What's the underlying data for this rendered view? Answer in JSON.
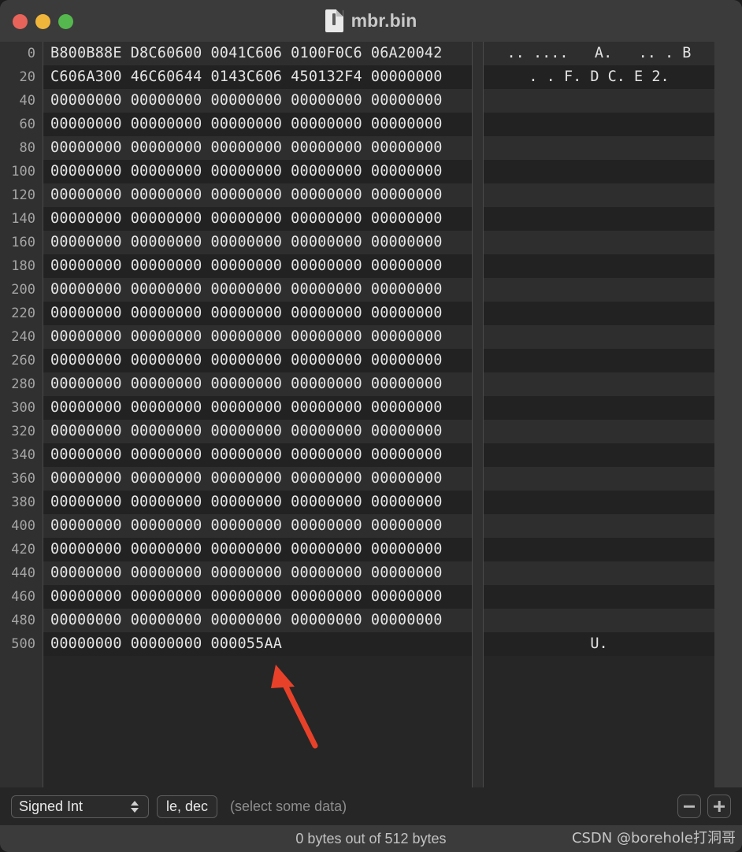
{
  "window": {
    "title": "mbr.bin",
    "doc_icon": "document-icon",
    "traffic_lights": [
      {
        "name": "close",
        "color": "#e8645a"
      },
      {
        "name": "minimize",
        "color": "#f0b63c"
      },
      {
        "name": "zoom",
        "color": "#55b84e"
      }
    ]
  },
  "editor": {
    "bytes_per_row": 32,
    "group_size_bytes": 4,
    "rows": [
      {
        "offset": "0",
        "hex": [
          "B800B88E",
          "D8C60600",
          "0041C606",
          "0100F0C6",
          "06A20042"
        ],
        "ascii": ".. ....   A.   .. . B"
      },
      {
        "offset": "20",
        "hex": [
          "C606A300",
          "46C60644",
          "0143C606",
          "450132F4",
          "00000000"
        ],
        "ascii": ". . F. D C. E 2."
      },
      {
        "offset": "40",
        "hex": [
          "00000000",
          "00000000",
          "00000000",
          "00000000",
          "00000000"
        ],
        "ascii": ""
      },
      {
        "offset": "60",
        "hex": [
          "00000000",
          "00000000",
          "00000000",
          "00000000",
          "00000000"
        ],
        "ascii": ""
      },
      {
        "offset": "80",
        "hex": [
          "00000000",
          "00000000",
          "00000000",
          "00000000",
          "00000000"
        ],
        "ascii": ""
      },
      {
        "offset": "100",
        "hex": [
          "00000000",
          "00000000",
          "00000000",
          "00000000",
          "00000000"
        ],
        "ascii": ""
      },
      {
        "offset": "120",
        "hex": [
          "00000000",
          "00000000",
          "00000000",
          "00000000",
          "00000000"
        ],
        "ascii": ""
      },
      {
        "offset": "140",
        "hex": [
          "00000000",
          "00000000",
          "00000000",
          "00000000",
          "00000000"
        ],
        "ascii": ""
      },
      {
        "offset": "160",
        "hex": [
          "00000000",
          "00000000",
          "00000000",
          "00000000",
          "00000000"
        ],
        "ascii": ""
      },
      {
        "offset": "180",
        "hex": [
          "00000000",
          "00000000",
          "00000000",
          "00000000",
          "00000000"
        ],
        "ascii": ""
      },
      {
        "offset": "200",
        "hex": [
          "00000000",
          "00000000",
          "00000000",
          "00000000",
          "00000000"
        ],
        "ascii": ""
      },
      {
        "offset": "220",
        "hex": [
          "00000000",
          "00000000",
          "00000000",
          "00000000",
          "00000000"
        ],
        "ascii": ""
      },
      {
        "offset": "240",
        "hex": [
          "00000000",
          "00000000",
          "00000000",
          "00000000",
          "00000000"
        ],
        "ascii": ""
      },
      {
        "offset": "260",
        "hex": [
          "00000000",
          "00000000",
          "00000000",
          "00000000",
          "00000000"
        ],
        "ascii": ""
      },
      {
        "offset": "280",
        "hex": [
          "00000000",
          "00000000",
          "00000000",
          "00000000",
          "00000000"
        ],
        "ascii": ""
      },
      {
        "offset": "300",
        "hex": [
          "00000000",
          "00000000",
          "00000000",
          "00000000",
          "00000000"
        ],
        "ascii": ""
      },
      {
        "offset": "320",
        "hex": [
          "00000000",
          "00000000",
          "00000000",
          "00000000",
          "00000000"
        ],
        "ascii": ""
      },
      {
        "offset": "340",
        "hex": [
          "00000000",
          "00000000",
          "00000000",
          "00000000",
          "00000000"
        ],
        "ascii": ""
      },
      {
        "offset": "360",
        "hex": [
          "00000000",
          "00000000",
          "00000000",
          "00000000",
          "00000000"
        ],
        "ascii": ""
      },
      {
        "offset": "380",
        "hex": [
          "00000000",
          "00000000",
          "00000000",
          "00000000",
          "00000000"
        ],
        "ascii": ""
      },
      {
        "offset": "400",
        "hex": [
          "00000000",
          "00000000",
          "00000000",
          "00000000",
          "00000000"
        ],
        "ascii": ""
      },
      {
        "offset": "420",
        "hex": [
          "00000000",
          "00000000",
          "00000000",
          "00000000",
          "00000000"
        ],
        "ascii": ""
      },
      {
        "offset": "440",
        "hex": [
          "00000000",
          "00000000",
          "00000000",
          "00000000",
          "00000000"
        ],
        "ascii": ""
      },
      {
        "offset": "460",
        "hex": [
          "00000000",
          "00000000",
          "00000000",
          "00000000",
          "00000000"
        ],
        "ascii": ""
      },
      {
        "offset": "480",
        "hex": [
          "00000000",
          "00000000",
          "00000000",
          "00000000",
          "00000000"
        ],
        "ascii": ""
      },
      {
        "offset": "500",
        "hex": [
          "00000000",
          "00000000",
          "000055AA"
        ],
        "ascii": "U."
      }
    ]
  },
  "annotation": {
    "type": "arrow",
    "color": "#e8412a",
    "points_at": "000055AA"
  },
  "inspector": {
    "type_selector": "Signed Int",
    "format_button": "le, dec",
    "hint": "(select some data)",
    "zoom_out": "minus-button",
    "zoom_in": "plus-button"
  },
  "statusbar": {
    "text": "0 bytes out of 512 bytes",
    "watermark": "CSDN @borehole打洞哥"
  }
}
